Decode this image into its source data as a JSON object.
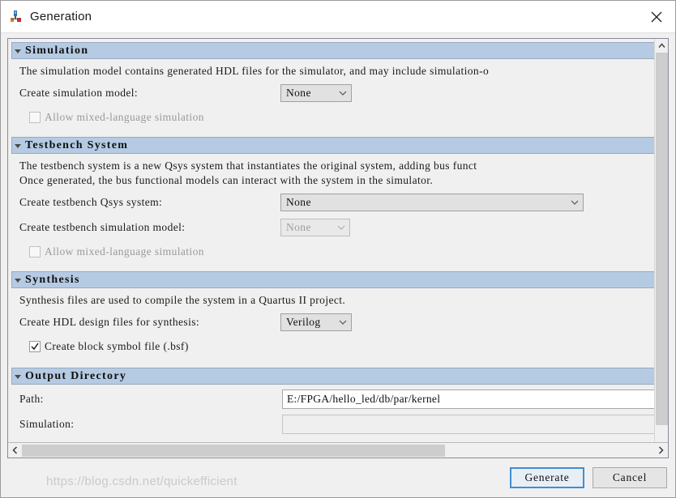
{
  "window": {
    "title": "Generation",
    "icon": "qsys-generation-icon",
    "close_icon": "close-icon"
  },
  "sections": {
    "simulation": {
      "header": "Simulation",
      "description": "The simulation model contains generated HDL files for the simulator, and may include simulation-o",
      "create_model_label": "Create simulation model:",
      "create_model_value": "None",
      "mixed_language_label": "Allow mixed-language simulation",
      "mixed_language_checked": false
    },
    "testbench": {
      "header": "Testbench System",
      "description_line1": "The testbench system is a new Qsys system that instantiates the original system, adding bus funct",
      "description_line2": "Once generated, the bus functional models can interact with the system in the simulator.",
      "create_qsys_label": "Create testbench Qsys system:",
      "create_qsys_value": "None",
      "create_sim_label": "Create testbench simulation model:",
      "create_sim_value": "None",
      "mixed_language_label": "Allow mixed-language simulation",
      "mixed_language_checked": false
    },
    "synthesis": {
      "header": "Synthesis",
      "description": "Synthesis files are used to compile the system in a Quartus II project.",
      "create_hdl_label": "Create HDL design files for synthesis:",
      "create_hdl_value": "Verilog",
      "block_symbol_label": "Create block symbol file (.bsf)",
      "block_symbol_checked": true
    },
    "output_directory": {
      "header": "Output Directory",
      "path_label": "Path:",
      "path_value": "E:/FPGA/hello_led/db/par/kernel",
      "simulation_label": "Simulation:",
      "simulation_value": ""
    }
  },
  "footer": {
    "generate_label": "Generate",
    "cancel_label": "Cancel",
    "watermark": "https://blog.csdn.net/quickefficient"
  },
  "colors": {
    "section_header_bg": "#b5cbe3",
    "focus_border": "#3f8fd2",
    "dialog_bg": "#f0f0f0",
    "scroll_thumb": "#cdcdcd"
  }
}
